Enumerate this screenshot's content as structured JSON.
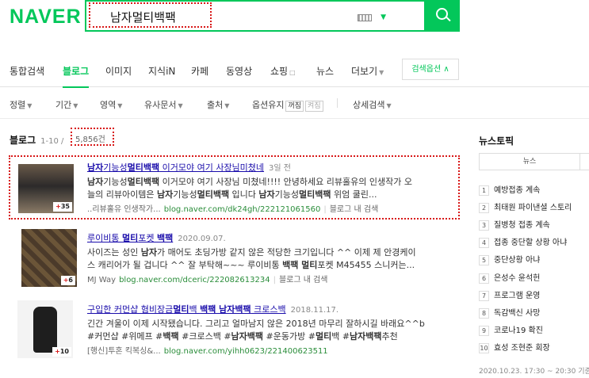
{
  "header": {
    "logo": "NAVER",
    "query": "남자멀티백팩"
  },
  "tabs": [
    {
      "label": "통합검색",
      "active": false
    },
    {
      "label": "블로그",
      "active": true
    },
    {
      "label": "이미지",
      "active": false
    },
    {
      "label": "지식iN",
      "active": false
    },
    {
      "label": "카페",
      "active": false
    },
    {
      "label": "동영상",
      "active": false
    },
    {
      "label": "쇼핑",
      "active": false
    },
    {
      "label": "뉴스",
      "active": false
    },
    {
      "label": "더보기",
      "active": false
    }
  ],
  "options_button": "검색옵션 ∧",
  "filters": {
    "items": [
      "정렬",
      "기간",
      "영역",
      "유사문서",
      "출처"
    ],
    "keep_option": "옵션유지",
    "on": "꺼짐",
    "off": "켜짐",
    "detail": "상세검색"
  },
  "blog": {
    "title": "블로그",
    "range": "1-10 /",
    "count": "5,856건"
  },
  "results": [
    {
      "title_parts": [
        [
          "남자",
          true
        ],
        [
          "기능성",
          false
        ],
        [
          "멀티백팩",
          true
        ],
        [
          " 이거모야 여기 사장님미쳤네",
          false
        ]
      ],
      "date": "3일 전",
      "desc1_parts": [
        [
          "남자",
          true
        ],
        [
          "기능성",
          false
        ],
        [
          "멀티백팩",
          true
        ],
        [
          " 이거모야 여기 사장님 미쳤네!!!! 안녕하세요 리뷰홀유의 인생작가 오",
          false
        ]
      ],
      "desc2_parts": [
        [
          "늘의 리뷰아이템은 ",
          false
        ],
        [
          "남자",
          true
        ],
        [
          "기능성",
          false
        ],
        [
          "멀티백팩",
          true
        ],
        [
          " 입니다 ",
          false
        ],
        [
          "남자",
          true
        ],
        [
          "기능성",
          false
        ],
        [
          "멀티백팩",
          true
        ],
        [
          " 위엄 쿨린...",
          false
        ]
      ],
      "source": "..리뷰홀유 인생작가...",
      "url": "blog.naver.com/dk24gh/222121061560",
      "blog_search": "블로그 내 검색",
      "count": "35"
    },
    {
      "title_parts": [
        [
          "루이비통 ",
          false
        ],
        [
          "멀티",
          true
        ],
        [
          "포켓 ",
          false
        ],
        [
          "백팩",
          true
        ]
      ],
      "date": "2020.09.07.",
      "desc1_parts": [
        [
          "사이즈는 성인 ",
          false
        ],
        [
          "남자",
          true
        ],
        [
          "가 매어도 초딩가방 같지 않은 적당한 크기입니다 ^^ 이제 제 안경케이",
          false
        ]
      ],
      "desc2_parts": [
        [
          "스 캐리어가 될 겁니다 ^^ 잘 부탁해~~~ 루이비통 ",
          false
        ],
        [
          "백팩 멀티",
          true
        ],
        [
          "포켓 M45455 스니커는...",
          false
        ]
      ],
      "source": "MJ Way",
      "url": "blog.naver.com/dceric/222082613234",
      "blog_search": "블로그 내 검색",
      "count": "6"
    },
    {
      "title_parts": [
        [
          "구입한 커먼샵 혐비장금",
          false
        ],
        [
          "멀티",
          true
        ],
        [
          "백 ",
          false
        ],
        [
          "백팩 남자백팩",
          true
        ],
        [
          " 크로스백",
          false
        ]
      ],
      "date": "2018.11.17.",
      "desc1_parts": [
        [
          "긴간 겨울이 이제 시작됐습니다. 그리고 얼마남지 않은 2018년 마무리 잘하시길 바래요^^b",
          false
        ]
      ],
      "desc2_parts": [
        [
          "#커먼샵 #위메프 #",
          false
        ],
        [
          "백팩",
          true
        ],
        [
          " #크로스백 #",
          false
        ],
        [
          "남자백팩",
          true
        ],
        [
          " #운동가방 #",
          false
        ],
        [
          "멀티",
          true
        ],
        [
          "백 #",
          false
        ],
        [
          "남자백팩",
          true
        ],
        [
          "추천",
          false
        ]
      ],
      "source": "[행신]투혼 킥복싱&...",
      "url": "blog.naver.com/yihh0623/221400623511",
      "blog_search": "",
      "count": "10"
    }
  ],
  "news": {
    "title": "뉴스토픽",
    "tab": "뉴스",
    "items": [
      "예방접종 계속",
      "최태원 파이낸셜 스토리",
      "질병청 접종 계속",
      "접종 중단할 상황 아냐",
      "중단상황 아냐",
      "은성수 윤석헌",
      "프로그램 운영",
      "독감백신 사망",
      "코로나19 확진",
      "효성 조현준 회장"
    ],
    "footer": "2020.10.23. 17:30 ~ 20:30 기준"
  }
}
